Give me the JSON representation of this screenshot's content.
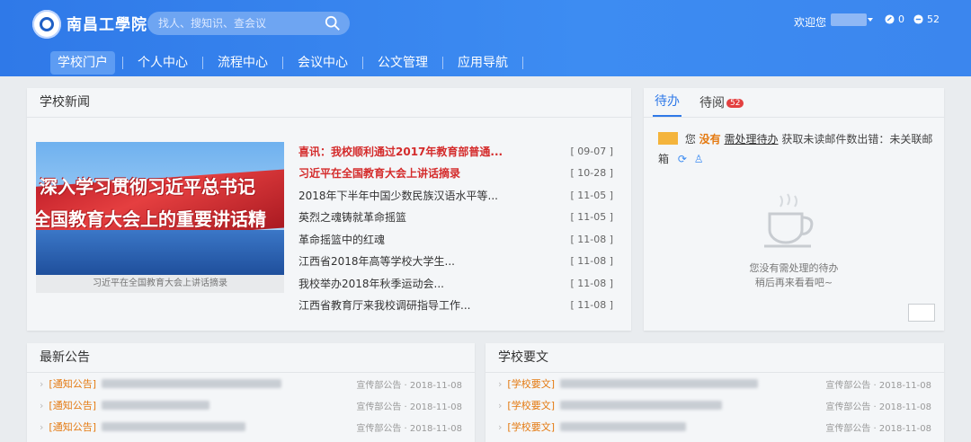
{
  "header": {
    "logo_text": "南昌工學院",
    "search_placeholder": "找人、搜知识、查会议",
    "welcome": "欢迎您",
    "stat_todo": "0",
    "stat_msgs": "52"
  },
  "nav": [
    "学校门户",
    "个人中心",
    "流程中心",
    "会议中心",
    "公文管理",
    "应用导航"
  ],
  "news": {
    "title": "学校新闻",
    "banner_line1": "深入学习贯彻习近平总书记",
    "banner_line2": "全国教育大会上的重要讲话精",
    "banner_caption": "习近平在全国教育大会上讲话摘录",
    "items": [
      {
        "title": "喜讯：我校顺利通过2017年教育部普通...",
        "date": "[ 09-07 ]",
        "highlight": true
      },
      {
        "title": "习近平在全国教育大会上讲话摘录",
        "date": "[ 10-28 ]",
        "highlight": true
      },
      {
        "title": "2018年下半年中国少数民族汉语水平等...",
        "date": "[ 11-05 ]",
        "highlight": false
      },
      {
        "title": "英烈之魂铸就革命摇篮",
        "date": "[ 11-05 ]",
        "highlight": false
      },
      {
        "title": "革命摇篮中的红魂",
        "date": "[ 11-08 ]",
        "highlight": false
      },
      {
        "title": "江西省2018年高等学校大学生...",
        "date": "[ 11-08 ]",
        "highlight": false
      },
      {
        "title": "我校举办2018年秋季运动会...",
        "date": "[ 11-08 ]",
        "highlight": false
      },
      {
        "title": "江西省教育厅来我校调研指导工作...",
        "date": "[ 11-08 ]",
        "highlight": false
      }
    ]
  },
  "todo": {
    "tab1": "待办",
    "tab2": "待阅",
    "tab2_badge": "52",
    "line_prefix": "您",
    "line_none": "没有",
    "line_link": "需处理待办",
    "line_rest": "获取未读邮件数出错：未关联邮箱",
    "empty1": "您没有需处理的待办",
    "empty2": "稍后再来看看吧~"
  },
  "notice": {
    "title": "最新公告",
    "tag": "[通知公告]",
    "meta": "宣传部公告 · 2018-11-08"
  },
  "school": {
    "title": "学校要文",
    "tag": "[学校要文]",
    "meta": "宣传部公告 · 2018-11-08"
  }
}
